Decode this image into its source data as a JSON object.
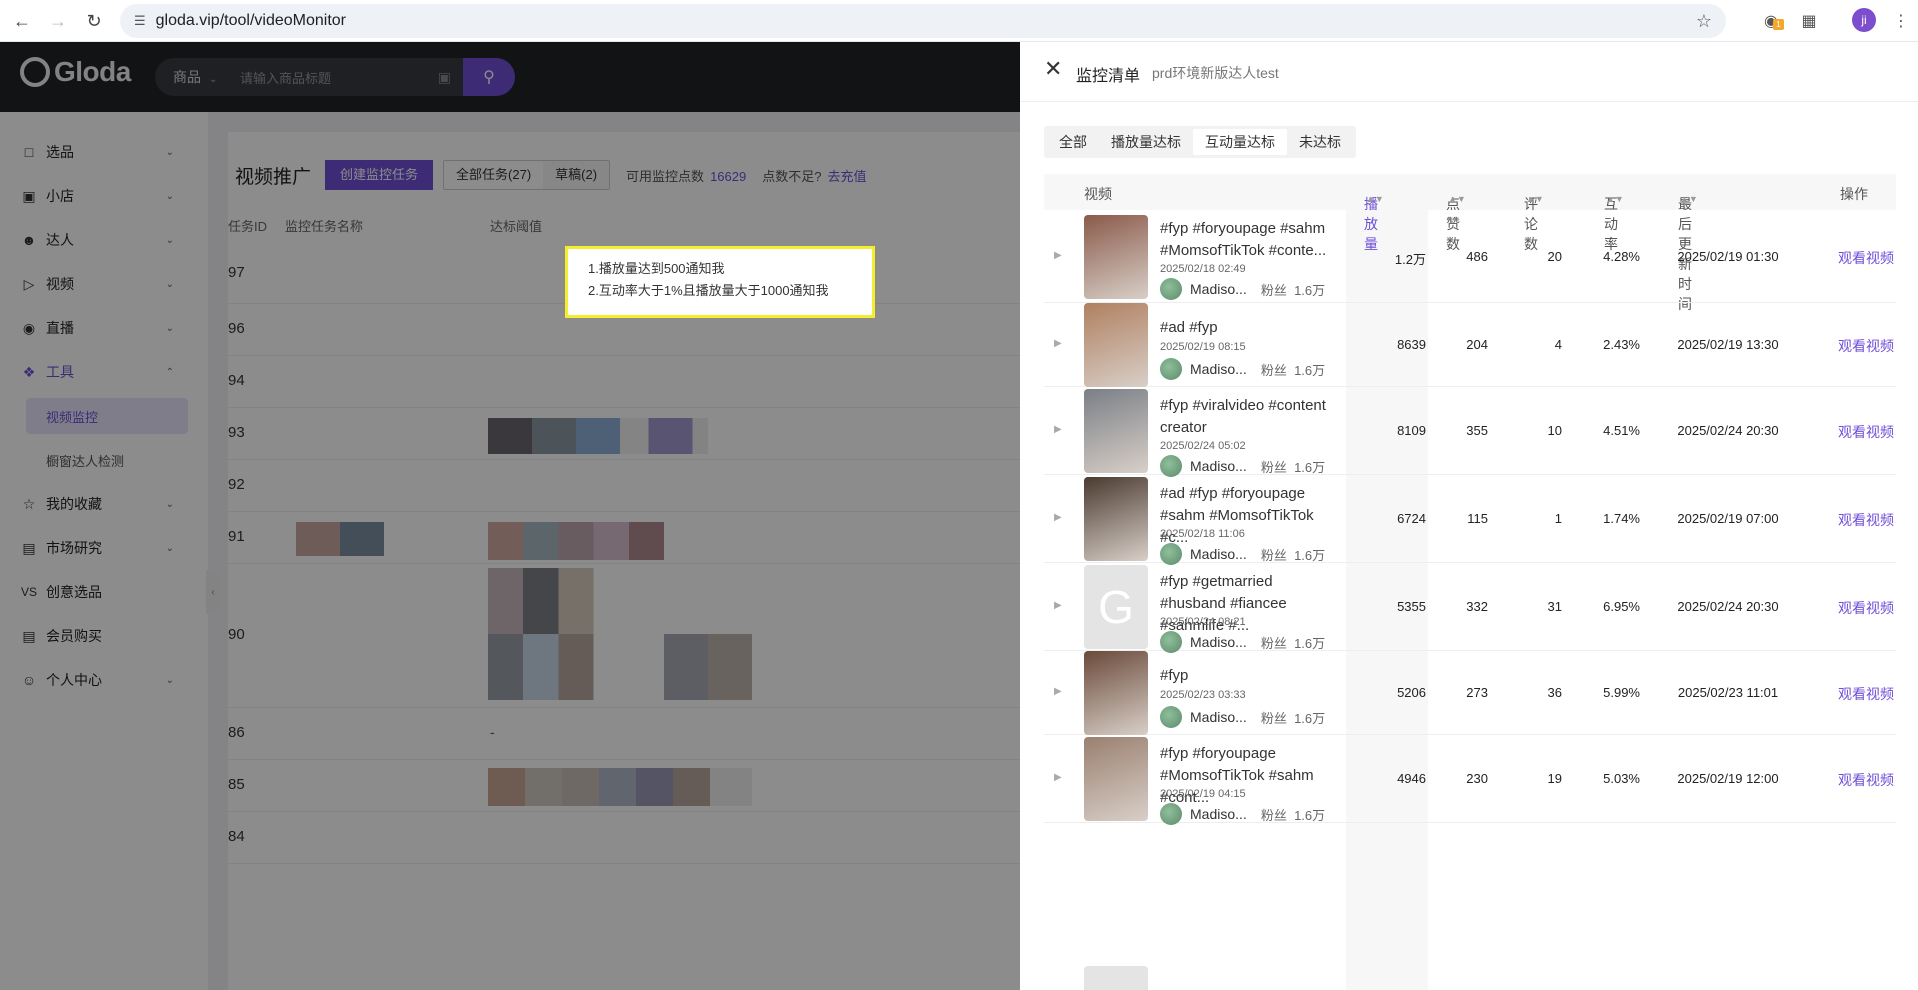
{
  "browser": {
    "url": "gloda.vip/tool/videoMonitor",
    "ext_badge": "1",
    "profile_initial": "ji"
  },
  "app": {
    "logo": "Gloda",
    "search_category": "商品",
    "search_placeholder": "请输入商品标题"
  },
  "sidebar": {
    "items": [
      {
        "label": "选品",
        "icon": "cube-icon"
      },
      {
        "label": "小店",
        "icon": "store-icon"
      },
      {
        "label": "达人",
        "icon": "user-icon"
      },
      {
        "label": "视频",
        "icon": "video-icon"
      },
      {
        "label": "直播",
        "icon": "live-icon"
      },
      {
        "label": "工具",
        "icon": "tool-icon"
      },
      {
        "label": "我的收藏",
        "icon": "star-icon"
      },
      {
        "label": "市场研究",
        "icon": "chart-icon"
      },
      {
        "label": "创意选品",
        "icon": "vs-icon"
      },
      {
        "label": "会员购买",
        "icon": "card-icon"
      },
      {
        "label": "个人中心",
        "icon": "smile-icon"
      }
    ],
    "sub_items": [
      "视频监控",
      "橱窗达人检测"
    ],
    "vs_text": "VS"
  },
  "main": {
    "title": "视频推广",
    "create_button": "创建监控任务",
    "tabs": [
      "全部任务(27)",
      "草稿(2)"
    ],
    "quota_label": "可用监控点数",
    "quota_value": "16629",
    "need_more": "点数不足?",
    "recharge": "去充值",
    "columns": [
      "任务ID",
      "监控任务名称",
      "达标阈值"
    ],
    "task_ids": [
      "97",
      "96",
      "94",
      "93",
      "92",
      "91",
      "90",
      "86",
      "85",
      "84"
    ],
    "row86_threshold": "-",
    "condition_lines": [
      "1.播放量达到500通知我",
      "2.互动率大于1%且播放量大于1000通知我"
    ]
  },
  "drawer": {
    "title": "监控清单",
    "subtitle": "prd环境新版达人test",
    "filter_tabs": [
      "全部",
      "播放量达标",
      "互动量达标",
      "未达标"
    ],
    "active_filter": "互动量达标",
    "columns": [
      "视频",
      "播放量",
      "点赞数",
      "评论数",
      "互动率",
      "最后更新时间",
      "操作"
    ],
    "rows": [
      {
        "title": "#fyp #foryoupage #sahm #MomsofTikTok #conte...",
        "date": "2025/02/18 02:49",
        "author": "Madiso...",
        "fans_label": "粉丝",
        "fans": "1.6万",
        "views": "1.2万",
        "likes": "486",
        "comments": "20",
        "rate": "4.28%",
        "updated": "2025/02/19 01:30",
        "action": "观看视频",
        "thumb": "#8a5a4a"
      },
      {
        "title": "#ad #fyp",
        "date": "2025/02/19 08:15",
        "author": "Madiso...",
        "fans_label": "粉丝",
        "fans": "1.6万",
        "views": "8639",
        "likes": "204",
        "comments": "4",
        "rate": "2.43%",
        "updated": "2025/02/19 13:30",
        "action": "观看视频",
        "thumb": "#b08060"
      },
      {
        "title": "#fyp #viralvideo #content creator",
        "date": "2025/02/24 05:02",
        "author": "Madiso...",
        "fans_label": "粉丝",
        "fans": "1.6万",
        "views": "8109",
        "likes": "355",
        "comments": "10",
        "rate": "4.51%",
        "updated": "2025/02/24 20:30",
        "action": "观看视频",
        "thumb": "#7a7f86"
      },
      {
        "title": "#ad #fyp #foryoupage #sahm #MomsofTikTok #c...",
        "date": "2025/02/18 11:06",
        "author": "Madiso...",
        "fans_label": "粉丝",
        "fans": "1.6万",
        "views": "6724",
        "likes": "115",
        "comments": "1",
        "rate": "1.74%",
        "updated": "2025/02/19 07:00",
        "action": "观看视频",
        "thumb": "#4a3a30"
      },
      {
        "title": "#fyp #getmarried #husband #fiancee #sahmlife #...",
        "date": "2025/02/24 08:21",
        "author": "Madiso...",
        "fans_label": "粉丝",
        "fans": "1.6万",
        "views": "5355",
        "likes": "332",
        "comments": "31",
        "rate": "6.95%",
        "updated": "2025/02/24 20:30",
        "action": "观看视频",
        "thumb": "G"
      },
      {
        "title": "#fyp",
        "date": "2025/02/23 03:33",
        "author": "Madiso...",
        "fans_label": "粉丝",
        "fans": "1.6万",
        "views": "5206",
        "likes": "273",
        "comments": "36",
        "rate": "5.99%",
        "updated": "2025/02/23 11:01",
        "action": "观看视频",
        "thumb": "#6a4a3a"
      },
      {
        "title": "#fyp #foryoupage #MomsofTikTok #sahm #cont...",
        "date": "2025/02/19 04:15",
        "author": "Madiso...",
        "fans_label": "粉丝",
        "fans": "1.6万",
        "views": "4946",
        "likes": "230",
        "comments": "19",
        "rate": "5.03%",
        "updated": "2025/02/19 12:00",
        "action": "观看视频",
        "thumb": "#9a8070"
      }
    ]
  },
  "colors": {
    "accent": "#6f4fd8",
    "highlight": "#f6ee2c",
    "header": "#222327"
  }
}
